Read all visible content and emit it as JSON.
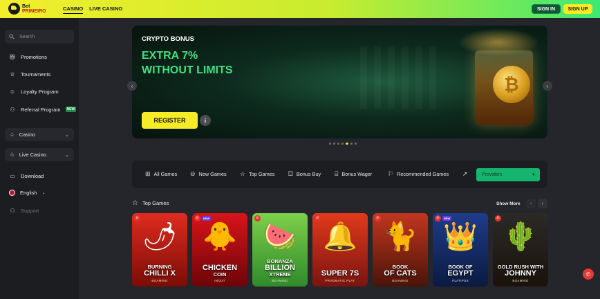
{
  "brand": {
    "line1": "Bet",
    "line2": "PRIMEIRO"
  },
  "topnav": {
    "casino": "CASINO",
    "live_casino": "LIVE CASINO"
  },
  "auth": {
    "sign_in": "SIGN IN",
    "sign_up": "SIGN UP"
  },
  "sidebar": {
    "search_placeholder": "Search",
    "items": [
      {
        "label": "Promotions",
        "icon": "gift-icon"
      },
      {
        "label": "Tournaments",
        "icon": "trophy-icon"
      },
      {
        "label": "Loyalty Program",
        "icon": "loyalty-icon"
      },
      {
        "label": "Referral Program",
        "icon": "referral-icon",
        "badge": "NEW"
      }
    ],
    "casino": "Casino",
    "live_casino": "Live Casino",
    "download": "Download",
    "language": "English",
    "support": "Support"
  },
  "banner": {
    "kicker": "CRYPTO BONUS",
    "headline1": "EXTRA 7%",
    "headline2": "WITHOUT LIMITS",
    "register": "REGISTER",
    "info": "i",
    "coin_symbol": "₿",
    "active_slide": 4,
    "slides": 7
  },
  "categories": [
    {
      "label": "All Games",
      "icon": "grid-icon"
    },
    {
      "label": "New Games",
      "icon": "new-icon"
    },
    {
      "label": "Top Games",
      "icon": "star-icon"
    },
    {
      "label": "Bonus Buy",
      "icon": "bag-icon"
    },
    {
      "label": "Bonus Wager",
      "icon": "gift-icon"
    },
    {
      "label": "Recommended Games",
      "icon": "flag-icon"
    },
    {
      "label": "",
      "icon": "rocket-icon"
    }
  ],
  "providers_label": "Providers",
  "top_games": {
    "title": "Top Games",
    "show_more": "Show More",
    "games": [
      {
        "line1": "BURNING",
        "line2": "CHILLI X",
        "provider": "BGAMING",
        "bg": "linear-gradient(180deg,#e02b1f,#7a0d06)",
        "art": "🌶",
        "new": false
      },
      {
        "line1": "",
        "line2": "CHICKEN",
        "line3": "COIN",
        "provider": "INOUT",
        "bg": "linear-gradient(180deg,#d8141a,#6d0508)",
        "art": "🐥",
        "new": true
      },
      {
        "line1": "BONANZA",
        "line2": "BILLION",
        "line3": "XTREME",
        "provider": "BGAMING",
        "bg": "linear-gradient(180deg,#7ed04a,#2f8a2b)",
        "art": "🍉",
        "new": false
      },
      {
        "line1": "",
        "line2": "SUPER 7S",
        "provider": "PRAGMATIC PLAY",
        "bg": "linear-gradient(180deg,#e23a1c,#7a1410)",
        "art": "🔔",
        "new": false
      },
      {
        "line1": "BOOK",
        "line2": "OF CATS",
        "provider": "BGAMING",
        "bg": "linear-gradient(180deg,#c2361f,#4a1408)",
        "art": "🐈",
        "new": false
      },
      {
        "line1": "BOOK OF",
        "line2": "EGYPT",
        "provider": "PLATIPUS",
        "bg": "linear-gradient(180deg,#1e3c8c,#0b1a40)",
        "art": "👑",
        "new": true
      },
      {
        "line1": "GOLD RUSH WITH",
        "line2": "JOHNNY",
        "provider": "BGAMING",
        "bg": "linear-gradient(180deg,#2b2a26,#1a120b)",
        "art": "🌵",
        "new": false
      }
    ]
  }
}
